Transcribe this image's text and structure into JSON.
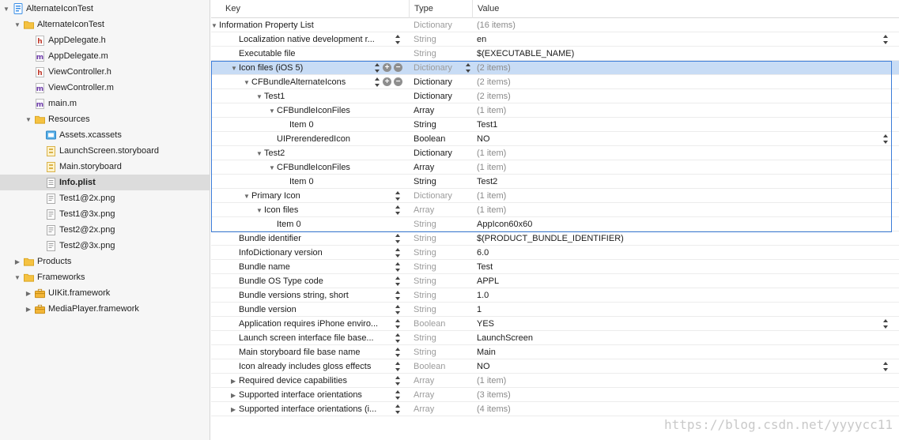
{
  "navigator": {
    "items": [
      {
        "label": "AlternateIconTest",
        "icon": "project-icon",
        "indent": 0,
        "disclosure": "open"
      },
      {
        "label": "AlternateIconTest",
        "icon": "folder-icon",
        "indent": 1,
        "disclosure": "open"
      },
      {
        "label": "AppDelegate.h",
        "icon": "header-file-icon",
        "indent": 2,
        "disclosure": ""
      },
      {
        "label": "AppDelegate.m",
        "icon": "objc-file-icon",
        "indent": 2,
        "disclosure": ""
      },
      {
        "label": "ViewController.h",
        "icon": "header-file-icon",
        "indent": 2,
        "disclosure": ""
      },
      {
        "label": "ViewController.m",
        "icon": "objc-file-icon",
        "indent": 2,
        "disclosure": ""
      },
      {
        "label": "main.m",
        "icon": "objc-file-icon",
        "indent": 2,
        "disclosure": ""
      },
      {
        "label": "Resources",
        "icon": "folder-icon",
        "indent": 2,
        "disclosure": "open"
      },
      {
        "label": "Assets.xcassets",
        "icon": "asset-catalog-icon",
        "indent": 3,
        "disclosure": ""
      },
      {
        "label": "LaunchScreen.storyboard",
        "icon": "storyboard-icon",
        "indent": 3,
        "disclosure": ""
      },
      {
        "label": "Main.storyboard",
        "icon": "storyboard-icon",
        "indent": 3,
        "disclosure": ""
      },
      {
        "label": "Info.plist",
        "icon": "plist-file-icon",
        "indent": 3,
        "disclosure": "",
        "selected": true
      },
      {
        "label": "Test1@2x.png",
        "icon": "image-file-icon",
        "indent": 3,
        "disclosure": ""
      },
      {
        "label": "Test1@3x.png",
        "icon": "image-file-icon",
        "indent": 3,
        "disclosure": ""
      },
      {
        "label": "Test2@2x.png",
        "icon": "image-file-icon",
        "indent": 3,
        "disclosure": ""
      },
      {
        "label": "Test2@3x.png",
        "icon": "image-file-icon",
        "indent": 3,
        "disclosure": ""
      },
      {
        "label": "Products",
        "icon": "folder-icon",
        "indent": 1,
        "disclosure": "closed"
      },
      {
        "label": "Frameworks",
        "icon": "folder-icon",
        "indent": 1,
        "disclosure": "open"
      },
      {
        "label": "UIKit.framework",
        "icon": "framework-icon",
        "indent": 2,
        "disclosure": "closed"
      },
      {
        "label": "MediaPlayer.framework",
        "icon": "framework-icon",
        "indent": 2,
        "disclosure": "closed"
      }
    ]
  },
  "editor": {
    "columns": {
      "key": "Key",
      "type": "Type",
      "value": "Value"
    },
    "rows": [
      {
        "key": "Information Property List",
        "type": "Dictionary",
        "value": "(16 items)",
        "level": 0,
        "tri": "open",
        "typeMuted": true,
        "valueMuted": true
      },
      {
        "key": "Localization native development r...",
        "type": "String",
        "value": "en",
        "level": 1,
        "keyStepper": true,
        "valueStepper": true,
        "typeMuted": true
      },
      {
        "key": "Executable file",
        "type": "String",
        "value": "$(EXECUTABLE_NAME)",
        "level": 1,
        "typeMuted": true
      },
      {
        "key": "Icon files (iOS 5)",
        "type": "Dictionary",
        "value": "(2 items)",
        "level": 1,
        "tri": "open",
        "keyStepper": true,
        "plusMinus": true,
        "typeStepper": true,
        "typeMuted": true,
        "valueMuted": true,
        "highlight": true
      },
      {
        "key": "CFBundleAlternateIcons",
        "type": "Dictionary",
        "value": "(2 items)",
        "level": 2,
        "tri": "open",
        "keyStepper": true,
        "plusMinus": true,
        "valueMuted": true
      },
      {
        "key": "Test1",
        "type": "Dictionary",
        "value": "(2 items)",
        "level": 3,
        "tri": "open",
        "valueMuted": true
      },
      {
        "key": "CFBundleIconFiles",
        "type": "Array",
        "value": "(1 item)",
        "level": 4,
        "tri": "open",
        "valueMuted": true
      },
      {
        "key": "Item 0",
        "type": "String",
        "value": "Test1",
        "level": 5
      },
      {
        "key": "UIPrerenderedIcon",
        "type": "Boolean",
        "value": "NO",
        "level": 4,
        "valueStepper": true
      },
      {
        "key": "Test2",
        "type": "Dictionary",
        "value": "(1 item)",
        "level": 3,
        "tri": "open",
        "valueMuted": true
      },
      {
        "key": "CFBundleIconFiles",
        "type": "Array",
        "value": "(1 item)",
        "level": 4,
        "tri": "open",
        "valueMuted": true
      },
      {
        "key": "Item 0",
        "type": "String",
        "value": "Test2",
        "level": 5
      },
      {
        "key": "Primary Icon",
        "type": "Dictionary",
        "value": "(1 item)",
        "level": 2,
        "tri": "open",
        "keyStepper": true,
        "typeMuted": true,
        "valueMuted": true
      },
      {
        "key": "Icon files",
        "type": "Array",
        "value": "(1 item)",
        "level": 3,
        "tri": "open",
        "keyStepper": true,
        "typeMuted": true,
        "valueMuted": true
      },
      {
        "key": "Item 0",
        "type": "String",
        "value": "AppIcon60x60",
        "level": 4,
        "typeMuted": true
      },
      {
        "key": "Bundle identifier",
        "type": "String",
        "value": "$(PRODUCT_BUNDLE_IDENTIFIER)",
        "level": 1,
        "keyStepper": true,
        "typeMuted": true
      },
      {
        "key": "InfoDictionary version",
        "type": "String",
        "value": "6.0",
        "level": 1,
        "keyStepper": true,
        "typeMuted": true
      },
      {
        "key": "Bundle name",
        "type": "String",
        "value": "Test",
        "level": 1,
        "keyStepper": true,
        "typeMuted": true
      },
      {
        "key": "Bundle OS Type code",
        "type": "String",
        "value": "APPL",
        "level": 1,
        "keyStepper": true,
        "typeMuted": true
      },
      {
        "key": "Bundle versions string, short",
        "type": "String",
        "value": "1.0",
        "level": 1,
        "keyStepper": true,
        "typeMuted": true
      },
      {
        "key": "Bundle version",
        "type": "String",
        "value": "1",
        "level": 1,
        "keyStepper": true,
        "typeMuted": true
      },
      {
        "key": "Application requires iPhone enviro...",
        "type": "Boolean",
        "value": "YES",
        "level": 1,
        "keyStepper": true,
        "valueStepper": true,
        "typeMuted": true
      },
      {
        "key": "Launch screen interface file base...",
        "type": "String",
        "value": "LaunchScreen",
        "level": 1,
        "keyStepper": true,
        "typeMuted": true
      },
      {
        "key": "Main storyboard file base name",
        "type": "String",
        "value": "Main",
        "level": 1,
        "keyStepper": true,
        "typeMuted": true
      },
      {
        "key": "Icon already includes gloss effects",
        "type": "Boolean",
        "value": "NO",
        "level": 1,
        "keyStepper": true,
        "valueStepper": true,
        "typeMuted": true
      },
      {
        "key": "Required device capabilities",
        "type": "Array",
        "value": "(1 item)",
        "level": 1,
        "tri": "closed",
        "keyStepper": true,
        "typeMuted": true,
        "valueMuted": true
      },
      {
        "key": "Supported interface orientations",
        "type": "Array",
        "value": "(3 items)",
        "level": 1,
        "tri": "closed",
        "keyStepper": true,
        "typeMuted": true,
        "valueMuted": true
      },
      {
        "key": "Supported interface orientations (i...",
        "type": "Array",
        "value": "(4 items)",
        "level": 1,
        "tri": "closed",
        "keyStepper": true,
        "typeMuted": true,
        "valueMuted": true
      }
    ]
  },
  "watermark": "https://blog.csdn.net/yyyycc11"
}
